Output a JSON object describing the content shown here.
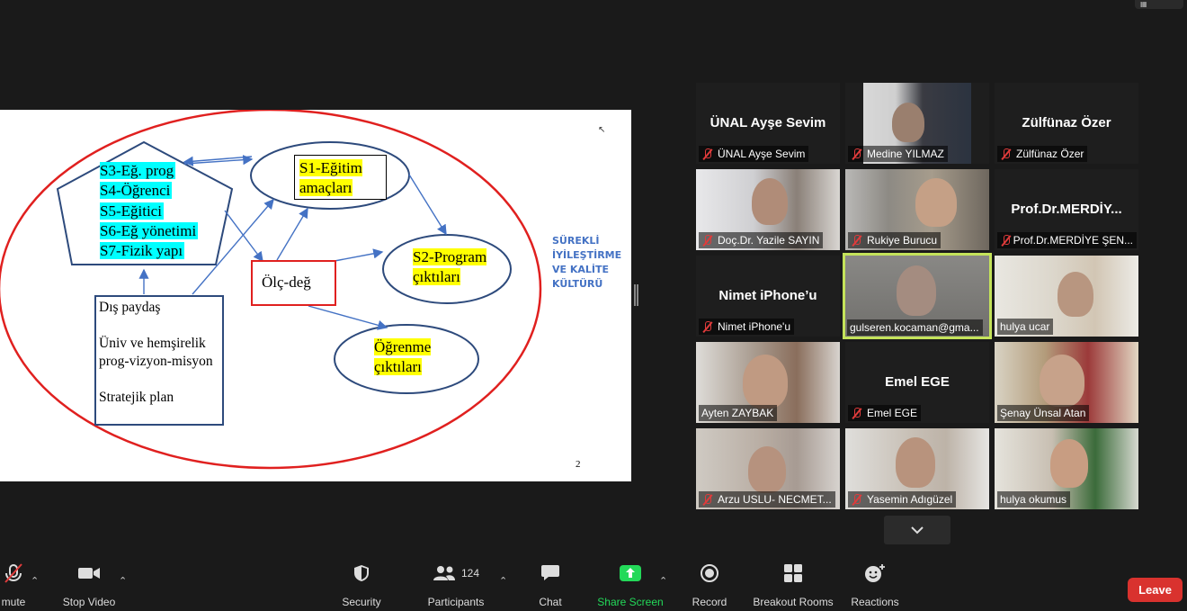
{
  "slide": {
    "pentagon_lines": [
      "S3-Eğ. prog",
      "S4-Öğrenci",
      "S5-Eğitici",
      "S6-Eğ yönetimi",
      "S7-Fizik yapı"
    ],
    "s1": [
      "S1-Eğitim",
      "amaçları"
    ],
    "s2": [
      "S2-Program",
      "çıktıları"
    ],
    "ogrenme": [
      "Öğrenme",
      "çıktıları"
    ],
    "olc": "Ölç-değ",
    "dis": [
      "Dış paydaş",
      "",
      "Üniv ve hemşirelik",
      "prog-vizyon-misyon",
      "",
      "Stratejik plan"
    ],
    "surekli": [
      "SÜREKLİ",
      "İYİLEŞTİRME",
      "VE KALİTE",
      "KÜLTÜRÜ"
    ],
    "page_number": "2",
    "colors": {
      "big_ellipse": "#e0201f",
      "shapes": "#2d4a7c",
      "highlight_cyan": "#00ffff",
      "highlight_yellow": "#ffff00",
      "arrow": "#4472c4"
    }
  },
  "participants": [
    {
      "name": "ÜNAL Ayşe Sevim",
      "big": "ÜNAL Ayşe Sevim",
      "muted": true,
      "video": false
    },
    {
      "name": "Medine YILMAZ",
      "big": "",
      "muted": true,
      "video": true
    },
    {
      "name": "Zülfünaz Özer",
      "big": "Zülfünaz Özer",
      "muted": true,
      "video": false
    },
    {
      "name": "Doç.Dr. Yazile SAYIN",
      "big": "",
      "muted": true,
      "video": true
    },
    {
      "name": "Rukiye Burucu",
      "big": "",
      "muted": true,
      "video": true
    },
    {
      "name": "Prof.Dr.MERDİYE ŞEN...",
      "big": "Prof.Dr.MERDİY...",
      "muted": true,
      "video": false
    },
    {
      "name": "Nimet iPhone'u",
      "big": "Nimet iPhone’u",
      "muted": true,
      "video": false
    },
    {
      "name": "gulseren.kocaman@gma...",
      "big": "",
      "muted": false,
      "video": true,
      "active_speaker": true
    },
    {
      "name": "hulya ucar",
      "big": "",
      "muted": false,
      "video": true
    },
    {
      "name": "Ayten ZAYBAK",
      "big": "",
      "muted": false,
      "video": true
    },
    {
      "name": "Emel EGE",
      "big": "Emel EGE",
      "muted": true,
      "video": false
    },
    {
      "name": "Şenay Ünsal Atan",
      "big": "",
      "muted": false,
      "video": true
    },
    {
      "name": "Arzu USLU- NECMET...",
      "big": "",
      "muted": true,
      "video": true
    },
    {
      "name": "Yasemin Adıgüzel",
      "big": "",
      "muted": true,
      "video": true
    },
    {
      "name": "hulya okumus",
      "big": "",
      "muted": false,
      "video": true
    }
  ],
  "toolbar": {
    "mute": "mute",
    "stop_video": "Stop Video",
    "security": "Security",
    "participants": "Participants",
    "participants_count": "124",
    "chat": "Chat",
    "share_screen": "Share Screen",
    "record": "Record",
    "breakout": "Breakout Rooms",
    "reactions": "Reactions",
    "leave": "Leave",
    "colors": {
      "share_green": "#23d959",
      "leave_red": "#d9322e"
    }
  }
}
